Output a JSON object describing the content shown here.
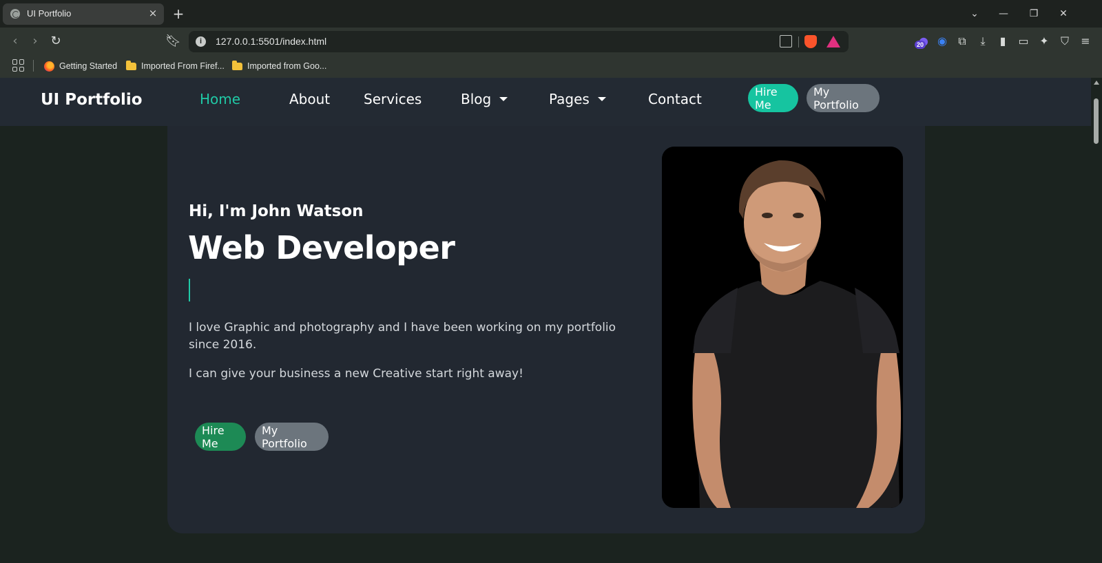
{
  "browser": {
    "tab_title": "UI Portfolio",
    "tab_close": "×",
    "new_tab": "+",
    "url": "127.0.0.1:5501/index.html",
    "extension_badge": "20",
    "bookmarks": [
      {
        "label": "Getting Started",
        "icon": "firefox-icon"
      },
      {
        "label": "Imported From Firef...",
        "icon": "folder-icon"
      },
      {
        "label": "Imported from Goo...",
        "icon": "folder-icon"
      }
    ]
  },
  "site": {
    "brand": "UI Portfolio",
    "nav": [
      "Home",
      "About",
      "Services",
      "Blog",
      "Pages",
      "Contact"
    ],
    "active_nav": "Home",
    "hire_label": "Hire Me",
    "portfolio_label": "My Portfolio",
    "accent_color": "#20c9a6"
  },
  "hero": {
    "greeting": "Hi, I'm John Watson",
    "role": "Web Developer",
    "paragraph1": "I love Graphic and photography and I have been working on my portfolio since 2016.",
    "paragraph2": "I can give your business a new Creative start right away!",
    "hire_label": "Hire Me",
    "portfolio_label": "My Portfolio"
  }
}
